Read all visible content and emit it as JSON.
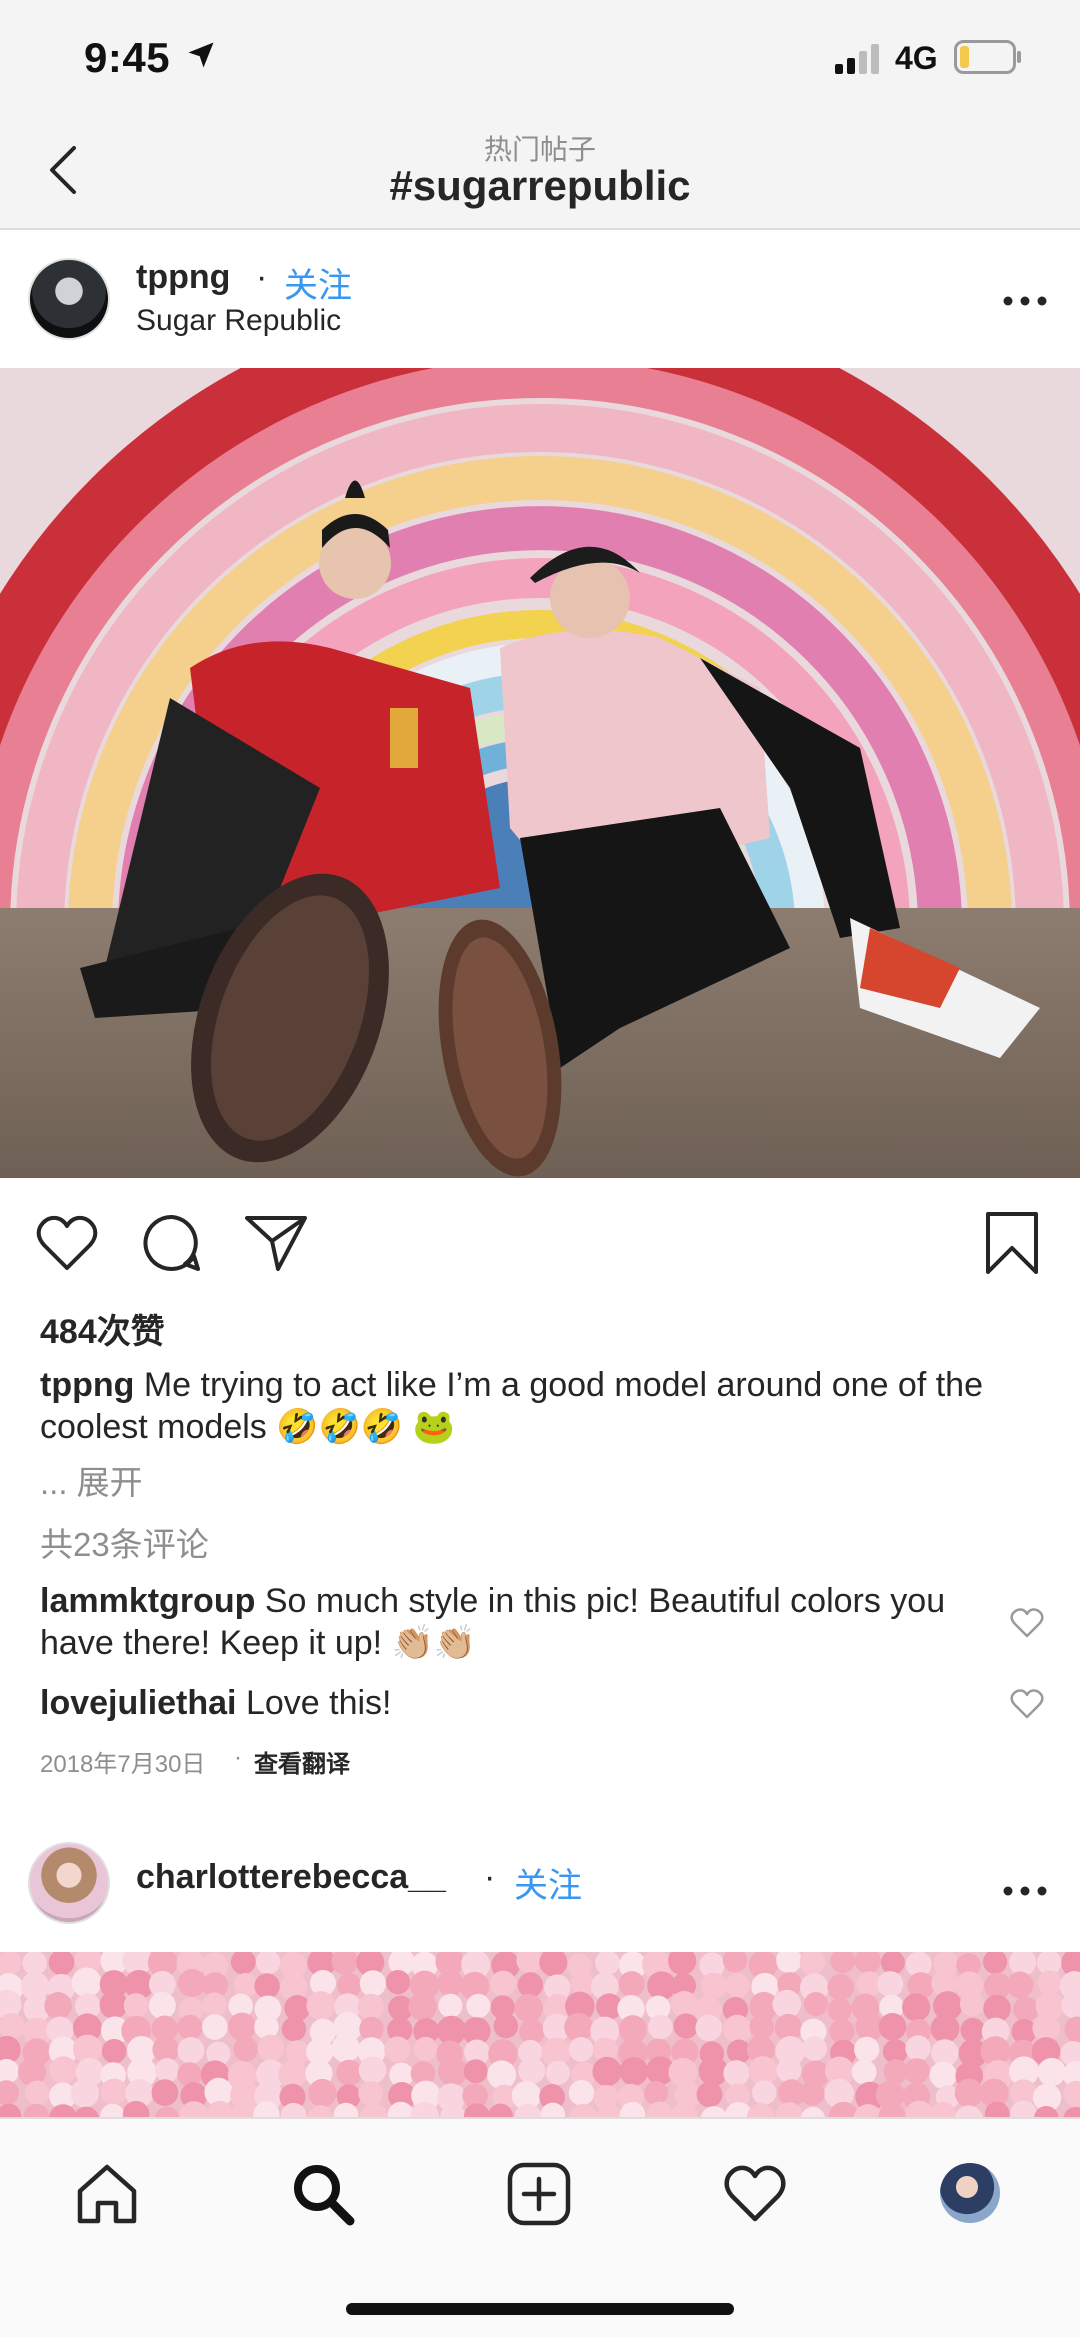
{
  "status": {
    "time": "9:45",
    "network": "4G"
  },
  "header": {
    "subtitle": "热门帖子",
    "title": "#sugarrepublic"
  },
  "post": {
    "username": "tppng",
    "separator": "·",
    "follow_label": "关注",
    "location": "Sugar Republic",
    "likes": "484次赞",
    "caption_user": "tppng",
    "caption_text": "Me trying to act like I’m a good model around one of the coolest models 🤣🤣🤣 🐸",
    "expand_label": "... 展开",
    "comment_count": "共23条评论",
    "comments": [
      {
        "user": "lammktgroup",
        "text": "So much style in this pic! Beautiful colors you have there! Keep it up! 👏🏼👏🏼"
      },
      {
        "user": "lovejuliethai",
        "text": "Love this!"
      }
    ],
    "date": "2018年7月30日",
    "date_sep": "·",
    "translate_label": "查看翻译"
  },
  "post2": {
    "username": "charlotterebecca__",
    "separator": "·",
    "follow_label": "关注"
  },
  "colors": {
    "accent": "#3897f0",
    "muted": "#8e8e8e",
    "text": "#262626"
  },
  "icons": {
    "back": "chevron-left-icon",
    "more": "more-horizontal-icon",
    "like": "heart-icon",
    "comment": "comment-bubble-icon",
    "share": "send-icon",
    "save": "bookmark-icon",
    "tabs": [
      "home-icon",
      "search-icon",
      "add-post-icon",
      "activity-heart-icon",
      "profile-avatar-icon"
    ]
  }
}
